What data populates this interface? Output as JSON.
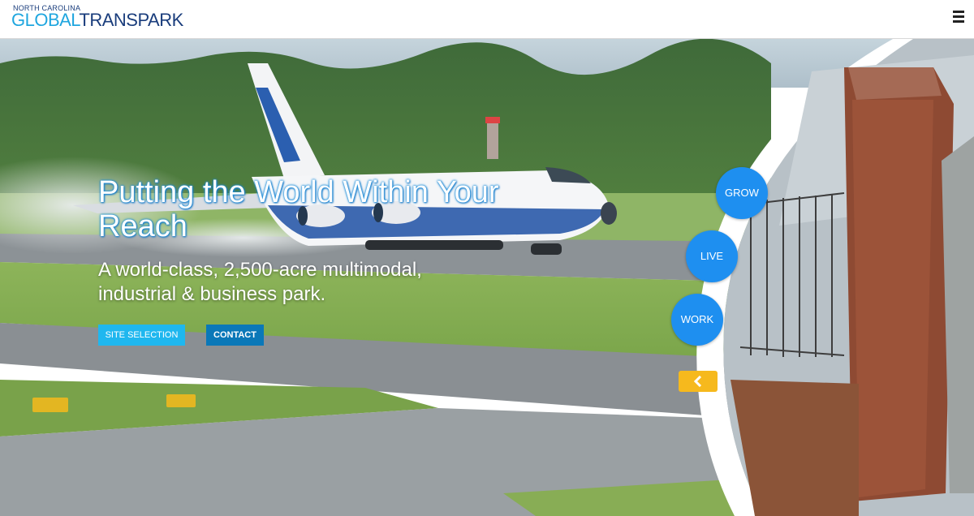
{
  "header": {
    "logo_top": "NORTH CAROLINA",
    "logo_word1": "GLOBAL",
    "logo_word2": "TRANSPARK",
    "menu_icon": "hamburger-icon"
  },
  "hero": {
    "headline": "Putting the World Within Your Reach",
    "subline": "A world-class, 2,500-acre multimodal, industrial & business park.",
    "buttons": {
      "site_selection": "SITE SELECTION",
      "contact": "CONTACT"
    },
    "circles": {
      "grow": "GROW",
      "live": "LIVE",
      "work": "WORK"
    },
    "arrow_icon": "chevron-left-icon"
  },
  "colors": {
    "brand_light_blue": "#1fa6df",
    "brand_dark_blue": "#1a3d7c",
    "circle_blue": "#1e8ff0",
    "arrow_yellow": "#f6b91d",
    "contact_blue": "#0a78b8"
  }
}
